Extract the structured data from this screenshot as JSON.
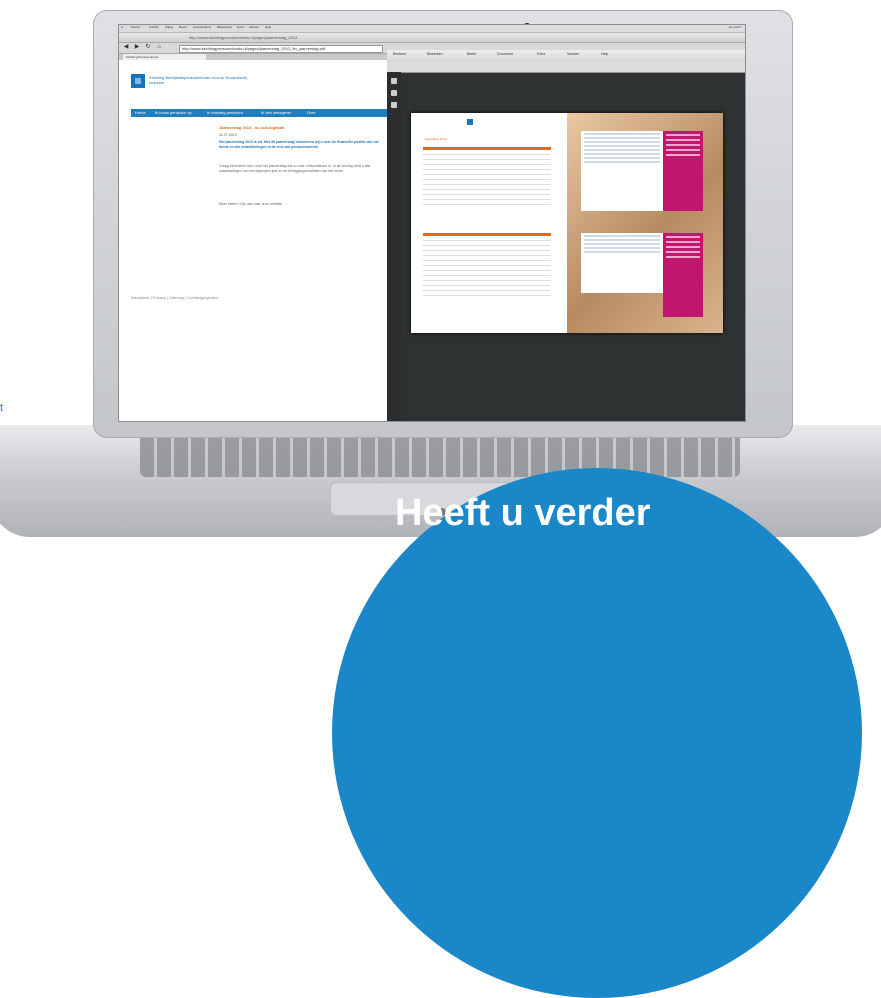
{
  "stray_text": "t",
  "browser": {
    "menu": [
      "Firefox",
      "Archief",
      "Wijzig",
      "Beeld",
      "Geschiedenis",
      "Bladwijzers",
      "Extra",
      "Venster",
      "Help"
    ],
    "menu_right": "wo 14:07",
    "window_title": "http://www.stichtingpensioenfonds.nl/pages/jaarverslag_2013",
    "url": "http://www.stichtingpensioenfonds.nl/pages/jaarverslag_2013_fin_jaarverslag.pdf",
    "tab_label": "Stichting Pensioenfonds"
  },
  "site": {
    "logo_text": "Stichting Bedrijfstakpensioenfonds voor de Koopvaardij Industrie",
    "nav": [
      "Home",
      "Ik bouw pensioen op",
      "Ik ontvang pensioen",
      "Ik ben werkgever",
      "Over"
    ],
    "article_title": "Jaarverslag 2013 - nu ook digitaal!",
    "article_date": "11-07-2013",
    "article_lead": "Het jaarverslag 2013 is uit. Met dit jaarverslag informeren wij u over de financiële positie van het fonds en alle ontwikkelingen in de rest van pensioenwereld.",
    "article_body": "Graag informeren wij u over het jaarverslag dat nu voor u beschikbaar is. In dit verslag vindt u alle ontwikkelingen van het afgelopen jaar en de beleggingsresultaten van het fonds.",
    "article_more": "Meer weten? Kijk dan naar onze website.",
    "footer": "Disclaimer  |  Privacy  |  Sitemap  |  Contactgegevens"
  },
  "pdf": {
    "toolbar": [
      "Bestand",
      "Bewerken",
      "Beeld",
      "Document",
      "Extra",
      "Venster",
      "Help"
    ],
    "page_left_heading": "Kerncijfers 2013"
  },
  "bubble": {
    "text": "Heeft u verder"
  },
  "colors": {
    "accent": "#1a87c8",
    "nav": "#1d7ec2",
    "orange": "#e06a1b",
    "magenta": "#c0166f"
  }
}
